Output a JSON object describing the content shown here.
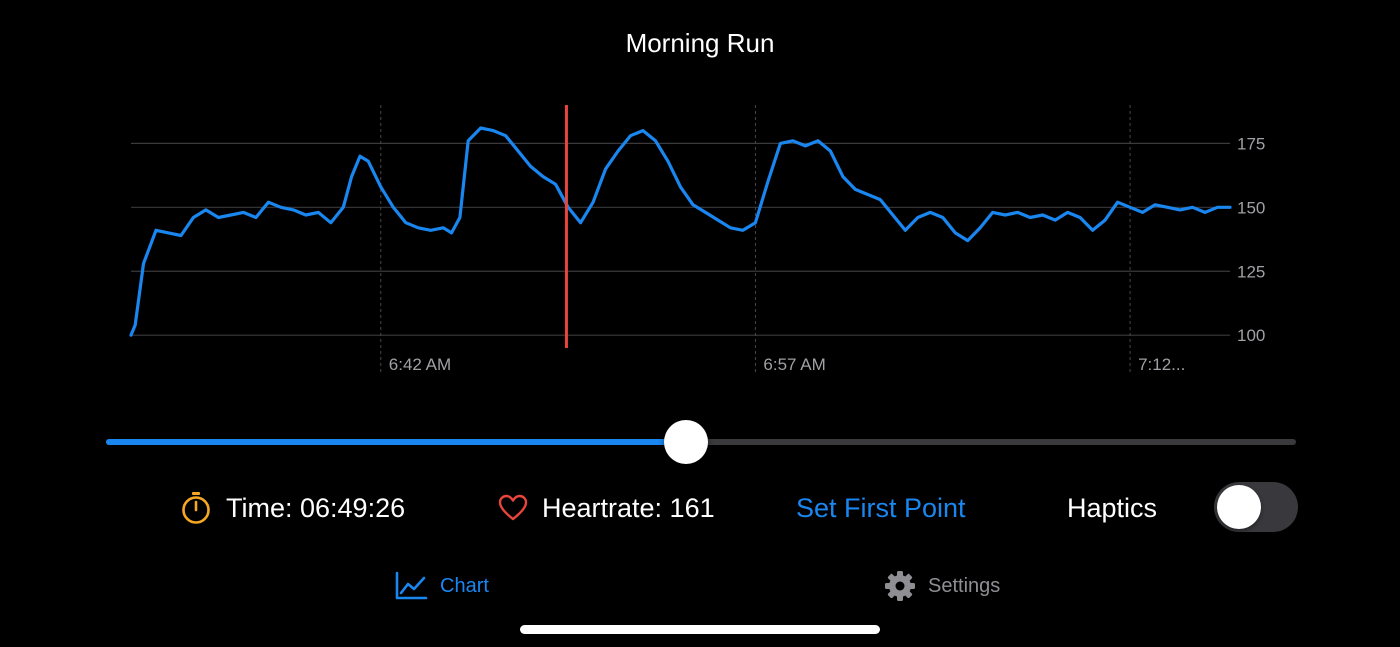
{
  "title": "Morning Run",
  "chart_data": {
    "type": "line",
    "title": "Morning Run",
    "xlabel": "",
    "ylabel": "",
    "x_axis": "time",
    "x_range": [
      "06:32:00",
      "07:16:00"
    ],
    "x_tick_labels": [
      "6:42 AM",
      "6:57 AM",
      "7:12..."
    ],
    "x_tick_times": [
      "06:42",
      "06:57",
      "07:12"
    ],
    "y_ticks": [
      100,
      125,
      150,
      175
    ],
    "ylim": [
      95,
      190
    ],
    "grid": "horizontal solid at y ticks, vertical dashed at x ticks",
    "cursor_time": "06:49:26",
    "series": [
      {
        "color": "#1a86f0",
        "x": [
          "06:32:00",
          "06:32:10",
          "06:32:30",
          "06:33:00",
          "06:33:30",
          "06:34:00",
          "06:34:30",
          "06:35:00",
          "06:35:30",
          "06:36:00",
          "06:36:30",
          "06:37:00",
          "06:37:30",
          "06:38:00",
          "06:38:30",
          "06:39:00",
          "06:39:30",
          "06:40:00",
          "06:40:30",
          "06:40:50",
          "06:41:10",
          "06:41:30",
          "06:42:00",
          "06:42:30",
          "06:43:00",
          "06:43:30",
          "06:44:00",
          "06:44:30",
          "06:44:50",
          "06:45:10",
          "06:45:30",
          "06:46:00",
          "06:46:30",
          "06:47:00",
          "06:47:30",
          "06:48:00",
          "06:48:30",
          "06:49:00",
          "06:49:30",
          "06:50:00",
          "06:50:30",
          "06:51:00",
          "06:51:30",
          "06:52:00",
          "06:52:30",
          "06:53:00",
          "06:53:30",
          "06:54:00",
          "06:54:30",
          "06:55:00",
          "06:55:30",
          "06:56:00",
          "06:56:30",
          "06:57:00",
          "06:57:30",
          "06:58:00",
          "06:58:30",
          "06:59:00",
          "06:59:30",
          "07:00:00",
          "07:00:30",
          "07:01:00",
          "07:01:30",
          "07:02:00",
          "07:02:30",
          "07:03:00",
          "07:03:30",
          "07:04:00",
          "07:04:30",
          "07:05:00",
          "07:05:30",
          "07:06:00",
          "07:06:30",
          "07:07:00",
          "07:07:30",
          "07:08:00",
          "07:08:30",
          "07:09:00",
          "07:09:30",
          "07:10:00",
          "07:10:30",
          "07:11:00",
          "07:11:30",
          "07:12:00",
          "07:12:30",
          "07:13:00",
          "07:13:30",
          "07:14:00",
          "07:14:30",
          "07:15:00",
          "07:15:30",
          "07:16:00"
        ],
        "values": [
          100,
          104,
          128,
          141,
          140,
          139,
          146,
          149,
          146,
          147,
          148,
          146,
          152,
          150,
          149,
          147,
          148,
          144,
          150,
          162,
          170,
          168,
          158,
          150,
          144,
          142,
          141,
          142,
          140,
          146,
          176,
          181,
          180,
          178,
          172,
          166,
          162,
          159,
          150,
          144,
          152,
          165,
          172,
          178,
          180,
          176,
          168,
          158,
          151,
          148,
          145,
          142,
          141,
          144,
          160,
          175,
          176,
          174,
          176,
          172,
          162,
          157,
          155,
          153,
          147,
          141,
          146,
          148,
          146,
          140,
          137,
          142,
          148,
          147,
          148,
          146,
          147,
          145,
          148,
          146,
          141,
          145,
          152,
          150,
          148,
          151,
          150,
          149,
          150,
          148,
          150,
          150
        ]
      }
    ]
  },
  "slider": {
    "value_fraction": 0.487
  },
  "info": {
    "time_label": "Time: 06:49:26",
    "heartrate_label": "Heartrate: 161",
    "set_first_point": "Set First Point",
    "haptics_label": "Haptics",
    "haptics_on": false
  },
  "tabs": [
    {
      "label": "Chart",
      "icon": "line-chart-icon",
      "active": true,
      "color": "#1a86f0"
    },
    {
      "label": "Settings",
      "icon": "gear-icon",
      "active": false,
      "color": "#8e8e93"
    }
  ],
  "colors": {
    "accent": "#1a86f0",
    "cursor_line": "#e8453c",
    "timer_icon": "#f5a623",
    "heart_icon": "#e8453c",
    "grid": "#3a3a3c",
    "axis_label": "#a0a0a5"
  }
}
